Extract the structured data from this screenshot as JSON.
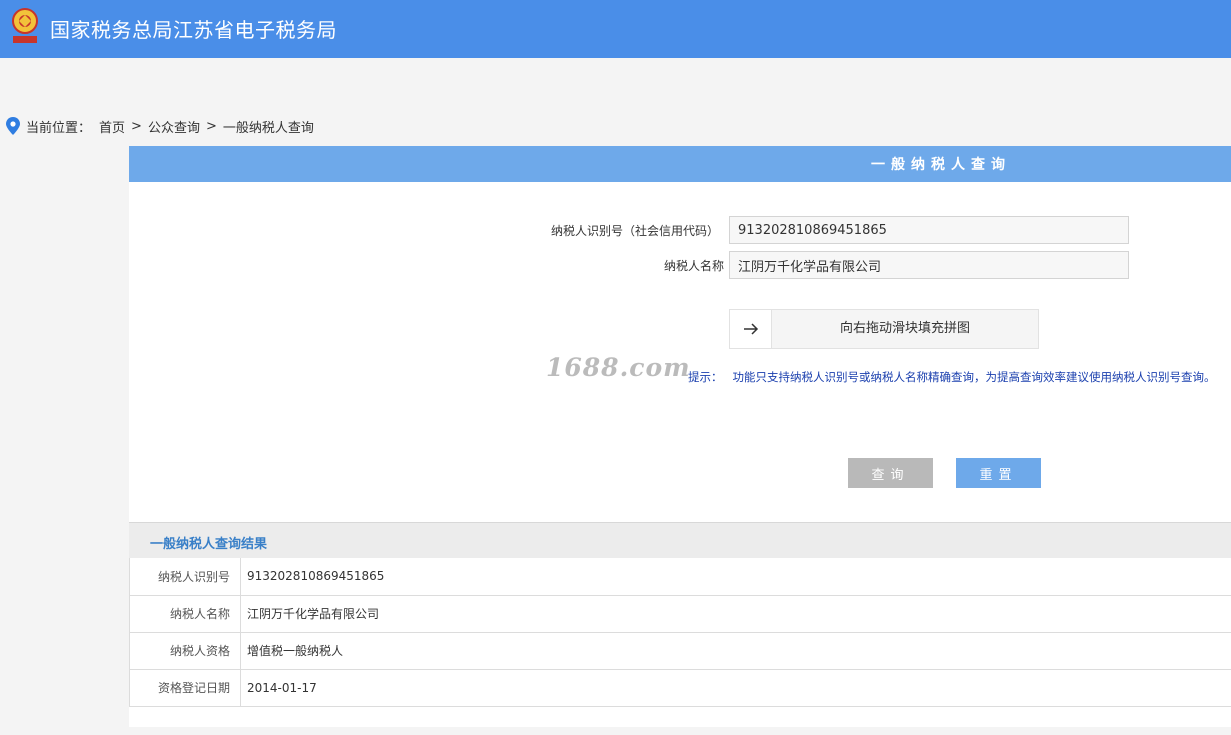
{
  "header": {
    "title": "国家税务总局江苏省电子税务局",
    "emblem_icon": "tax-emblem-icon"
  },
  "breadcrumb": {
    "label": "当前位置：",
    "items": [
      "首页",
      "公众查询",
      "一般纳税人查询"
    ],
    "separator": ">"
  },
  "panel": {
    "title": "一般纳税人查询"
  },
  "form": {
    "taxpayer_id_label": "纳税人识别号（社会信用代码）",
    "taxpayer_id_value": "913202810869451865",
    "taxpayer_name_label": "纳税人名称",
    "taxpayer_name_value": "江阴万千化学品有限公司",
    "slider_text": "向右拖动滑块填充拼图",
    "hint_label": "提示：",
    "hint_text": "功能只支持纳税人识别号或纳税人名称精确查询，为提高查询效率建议使用纳税人识别号查询。",
    "query_button": "查询",
    "reset_button": "重置"
  },
  "watermark": "1688.com",
  "result": {
    "title": "一般纳税人查询结果",
    "rows": [
      {
        "label": "纳税人识别号",
        "value": "913202810869451865"
      },
      {
        "label": "纳税人名称",
        "value": "江阴万千化学品有限公司"
      },
      {
        "label": "纳税人资格",
        "value": "增值税一般纳税人"
      },
      {
        "label": "资格登记日期",
        "value": "2014-01-17"
      }
    ]
  },
  "colors": {
    "header_bg": "#4a8ee8",
    "panel_header_bg": "#6ea9ea",
    "hint_text": "#1a3fae",
    "result_title": "#3a80c8"
  }
}
